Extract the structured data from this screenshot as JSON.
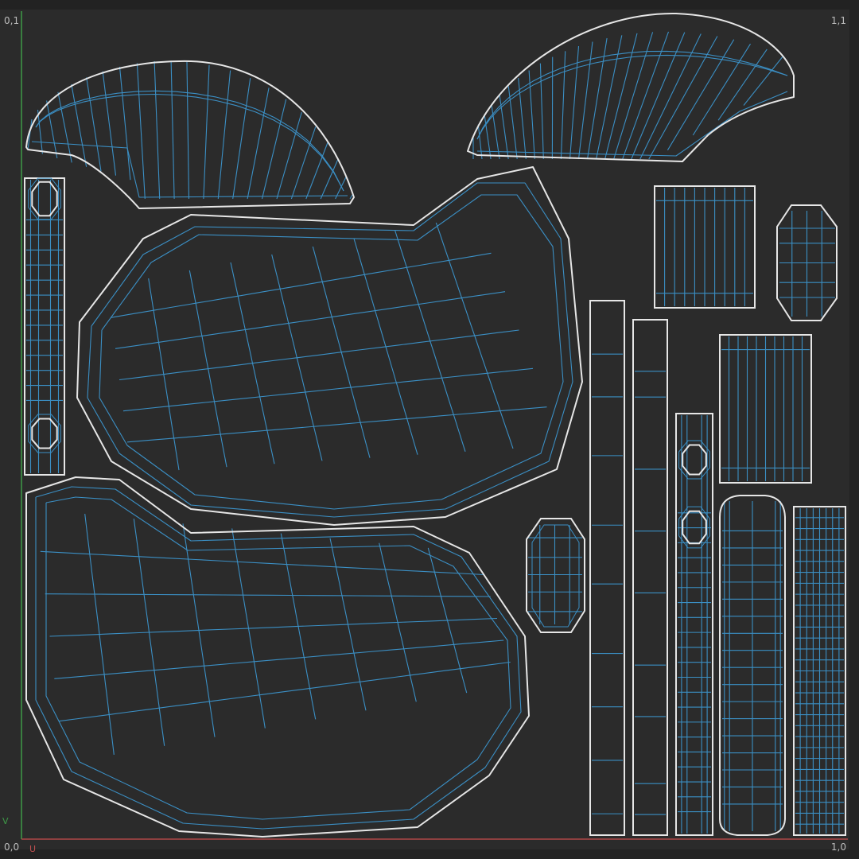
{
  "corners": {
    "top_left": "0,1",
    "top_right": "1,1",
    "bottom_left": "0,0",
    "bottom_right": "1,0"
  },
  "axes": {
    "v_label": "V",
    "u_label": "U"
  },
  "colors": {
    "background": "#2b2b2b",
    "border_band": "#222222",
    "outline": "#e6e6e6",
    "wire": "#3b8fc4",
    "v_axis": "#3e9a48",
    "u_axis": "#b04848",
    "text": "#bdbdbd"
  },
  "uv_islands": [
    "cap-top-left",
    "cap-top-right",
    "strap-left",
    "shell-upper",
    "shell-lower",
    "oval-small-left",
    "strip-1",
    "strip-2",
    "strip-3-holes",
    "panel-top",
    "oval-small-right",
    "panel-mid",
    "bar-rounded",
    "strip-dense"
  ]
}
